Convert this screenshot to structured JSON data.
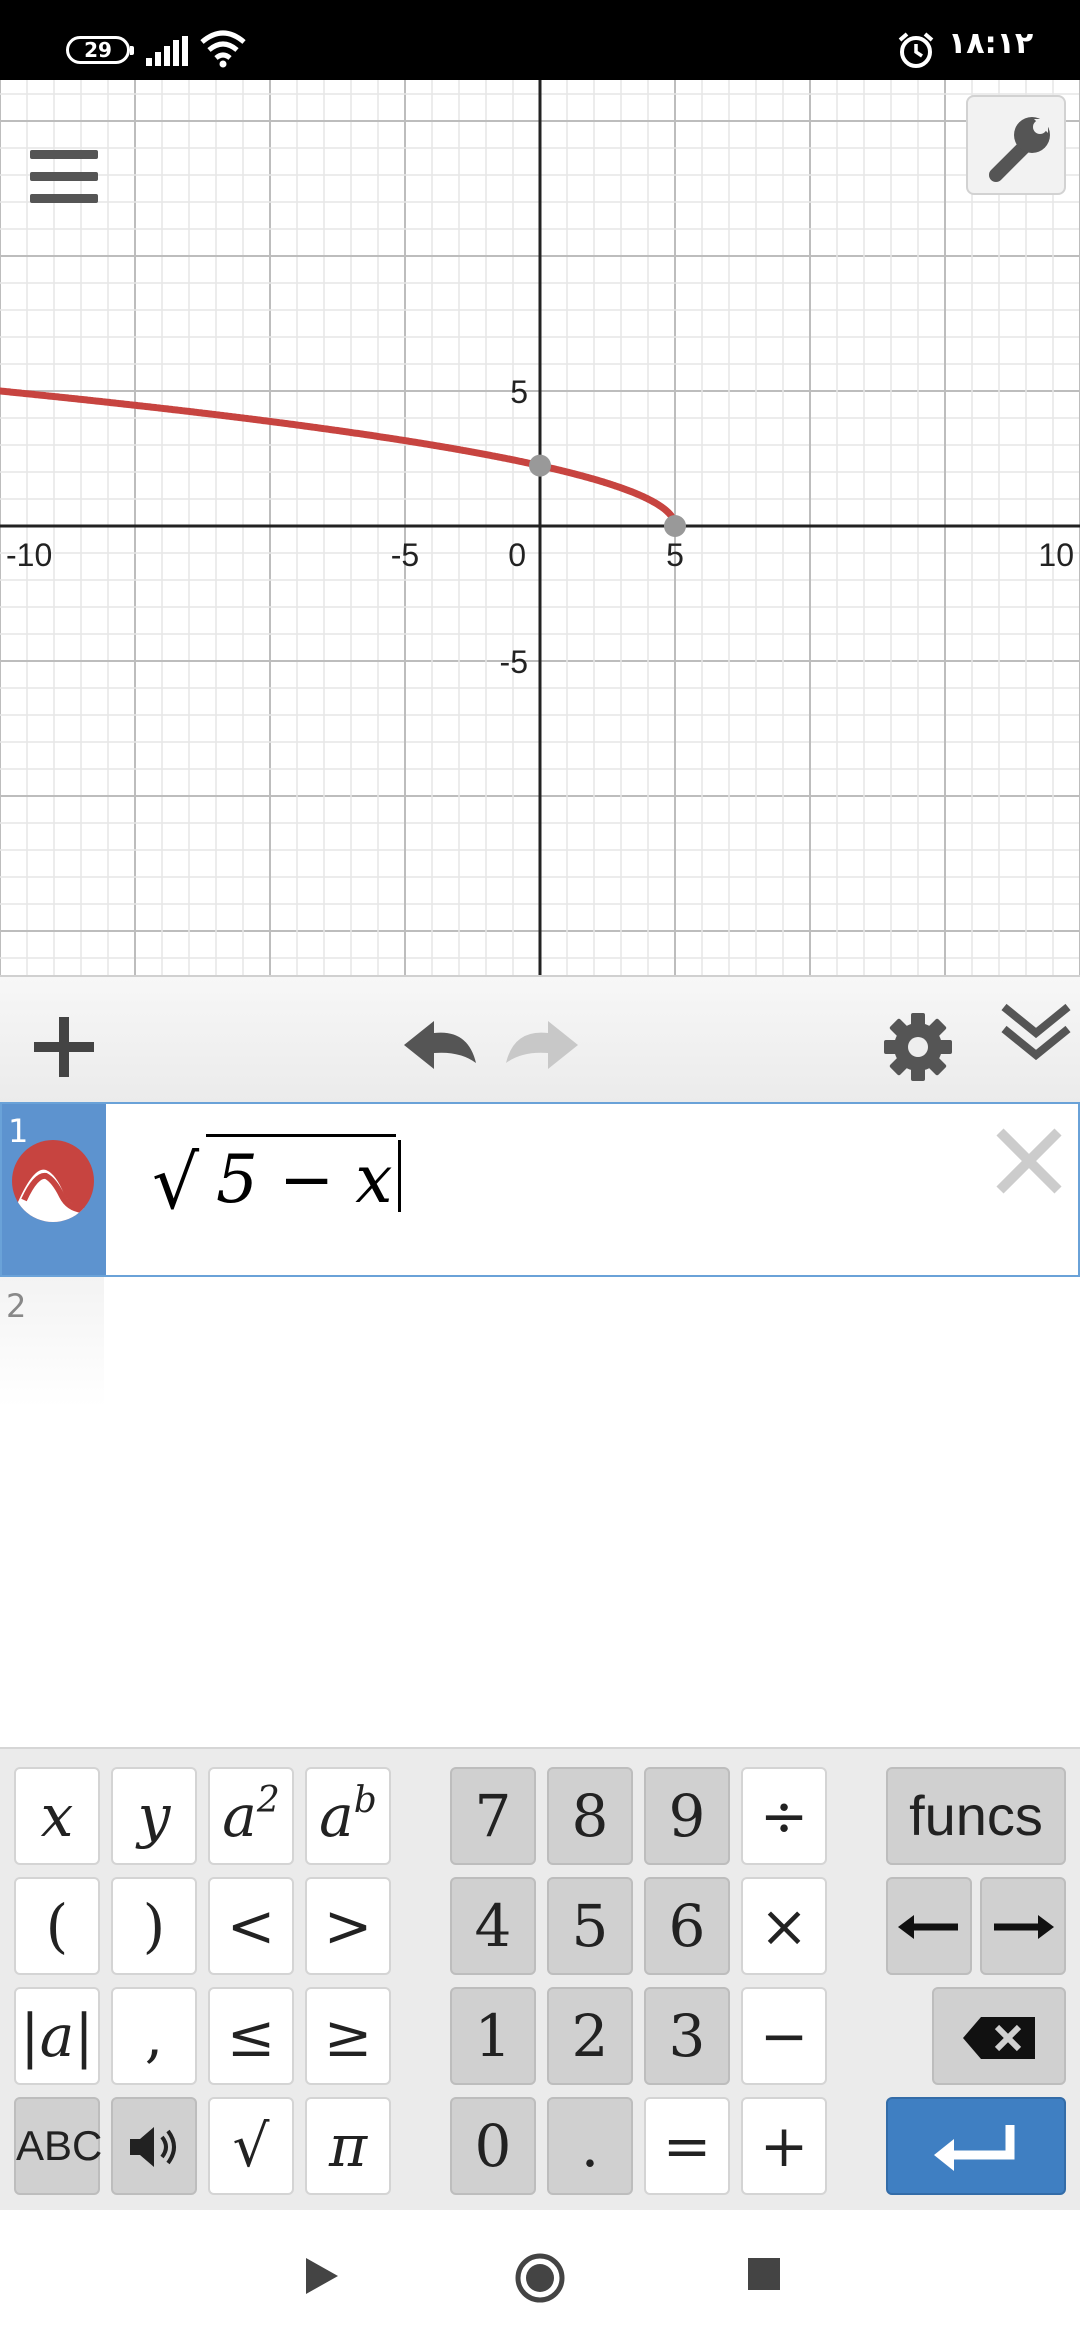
{
  "status_bar": {
    "battery_level": "29",
    "time": "۱۸:۱۲",
    "icons": [
      "signal-icon",
      "wifi-icon",
      "alarm-icon"
    ]
  },
  "graph": {
    "x_ticks": [
      "-10",
      "-5",
      "0",
      "5",
      "10"
    ],
    "y_ticks": [
      "5",
      "-5"
    ],
    "curve_color": "#c74440",
    "point_color": "#999999",
    "curve_function": "sqrt(5 - x)",
    "x_range": [
      -10,
      10
    ],
    "y_range": [
      -8.2,
      8.6
    ],
    "grid": true,
    "points": [
      {
        "x": 0,
        "y": 2.236
      },
      {
        "x": 5,
        "y": 0
      }
    ]
  },
  "toolbar": {
    "add_icon": "plus-icon",
    "undo_icon": "undo-icon",
    "redo_icon": "redo-icon",
    "settings_icon": "gear-icon",
    "collapse_icon": "double-chevron-down-icon"
  },
  "expressions": [
    {
      "number": "1",
      "math_prefix": "√",
      "math_body": "5 − x",
      "color": "#c74440"
    },
    {
      "number": "2",
      "math_body": ""
    }
  ],
  "keypad": {
    "left": [
      [
        "x",
        "y",
        "a²",
        "aᵇ"
      ],
      [
        "(",
        ")",
        "<",
        ">"
      ],
      [
        "|a|",
        ",",
        "≤",
        "≥"
      ],
      [
        "ABC",
        "speaker-icon",
        "√",
        "π"
      ]
    ],
    "numbers": [
      [
        "7",
        "8",
        "9",
        "÷"
      ],
      [
        "4",
        "5",
        "6",
        "×"
      ],
      [
        "1",
        "2",
        "3",
        "−"
      ],
      [
        "0",
        ".",
        "=",
        "+"
      ]
    ],
    "funcs_label": "funcs",
    "arrow_left": "⟵",
    "arrow_right": "⟶"
  },
  "accent_color": "#3f7fc2"
}
